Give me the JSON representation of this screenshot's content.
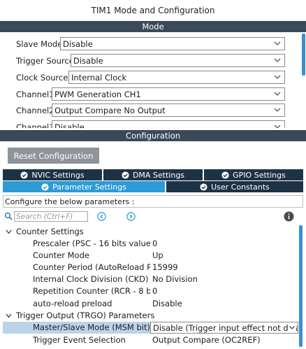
{
  "window": {
    "title": "TIM1 Mode and Configuration"
  },
  "mode": {
    "header": "Mode",
    "rows": [
      {
        "label": "Slave Mode",
        "value": "Disable"
      },
      {
        "label": "Trigger Source",
        "value": "Disable"
      },
      {
        "label": "Clock Source",
        "value": "Internal Clock"
      },
      {
        "label": "Channel1",
        "value": "PWM Generation CH1"
      },
      {
        "label": "Channel2",
        "value": "Output Compare No Output"
      },
      {
        "label": "Channel3",
        "value": "Disable"
      }
    ]
  },
  "configuration": {
    "header": "Configuration",
    "reset_label": "Reset Configuration",
    "tabs_row1": [
      {
        "label": "NVIC Settings",
        "icon": "check-circle-icon"
      },
      {
        "label": "DMA Settings",
        "icon": "check-circle-icon"
      },
      {
        "label": "GPIO Settings",
        "icon": "check-circle-icon"
      }
    ],
    "tabs_row2": [
      {
        "label": "Parameter Settings",
        "icon": "check-circle-icon",
        "active": true
      },
      {
        "label": "User Constants",
        "icon": "check-circle-icon",
        "active": false
      }
    ],
    "configure_text": "Configure the below parameters :",
    "search": {
      "placeholder": "Search (Ctrl+F)"
    },
    "tree": {
      "counter_settings": {
        "label": "Counter Settings",
        "params": [
          {
            "name": "Prescaler (PSC - 16 bits value)",
            "value": "0"
          },
          {
            "name": "Counter Mode",
            "value": "Up"
          },
          {
            "name": "Counter Period (AutoReload Register - 16 bits value)",
            "value": "15999"
          },
          {
            "name": "Internal Clock Division (CKD)",
            "value": "No Division"
          },
          {
            "name": "Repetition Counter (RCR - 8 bits value)",
            "value": "0"
          },
          {
            "name": "auto-reload preload",
            "value": "Disable"
          }
        ]
      },
      "trgo": {
        "label": "Trigger Output (TRGO) Parameters",
        "params": [
          {
            "name": "Master/Slave Mode (MSM bit)",
            "value": "Disable (Trigger input effect not delayed)"
          },
          {
            "name": "Trigger Event Selection",
            "value": "Output Compare (OC2REF)"
          }
        ]
      }
    }
  },
  "colors": {
    "header_bg": "#3a4a5a",
    "tab_dark": "#1e3246",
    "tab_active": "#2c9bd6",
    "scrollbar": "#3a8fd2",
    "selection": "#bcd3ea",
    "reset_button": "#8e949a"
  }
}
